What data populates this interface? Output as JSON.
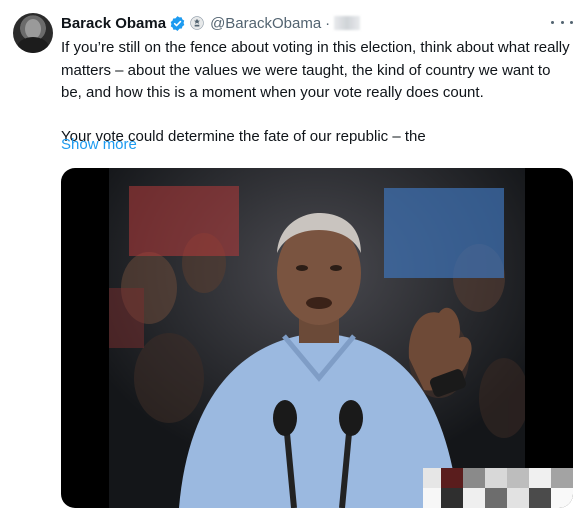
{
  "author": {
    "display_name": "Barack Obama",
    "handle": "@BarackObama",
    "separator": "·"
  },
  "tweet": {
    "paragraph1": "If you’re still on the fence about voting in this election, think about what really matters – about the values we were taught, the kind of country we want to be, and how this is a moment when your vote really does count.",
    "paragraph2": "Your vote could determine the fate of our republic – the",
    "show_more": "Show more"
  },
  "icons": {
    "verified": "verified-badge-icon",
    "affiliation": "government-seal-icon",
    "more": "more-options-icon"
  },
  "colors": {
    "accent": "#1d9bf0",
    "text": "#0f1419",
    "secondary": "#536471"
  }
}
